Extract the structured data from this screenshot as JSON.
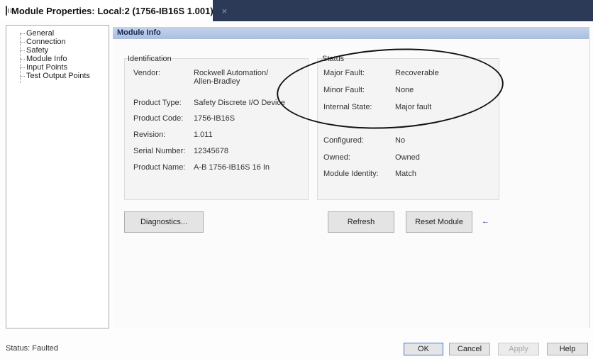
{
  "window": {
    "title": "Module Properties: Local:2 (1756-IB16S 1.001)",
    "close_glyph": "×"
  },
  "tree": {
    "items": [
      "General",
      "Connection",
      "Safety",
      "Module Info",
      "Input Points",
      "Test Output Points"
    ]
  },
  "panel": {
    "title": "Module Info"
  },
  "identification": {
    "label": "Identification",
    "vendor_label": "Vendor:",
    "vendor_value_line1": "Rockwell Automation/",
    "vendor_value_line2": "Allen-Bradley",
    "product_type_label": "Product Type:",
    "product_type_value": "Safety Discrete I/O Device",
    "product_code_label": "Product Code:",
    "product_code_value": "1756-IB16S",
    "revision_label": "Revision:",
    "revision_value": "1.011",
    "serial_label": "Serial Number:",
    "serial_value": "12345678",
    "product_name_label": "Product Name:",
    "product_name_value": "A-B 1756-IB16S 16 In"
  },
  "status": {
    "label": "Status",
    "major_fault_label": "Major Fault:",
    "major_fault_value": "Recoverable",
    "minor_fault_label": "Minor Fault:",
    "minor_fault_value": "None",
    "internal_state_label": "Internal State:",
    "internal_state_value": "Major fault",
    "configured_label": "Configured:",
    "configured_value": "No",
    "owned_label": "Owned:",
    "owned_value": "Owned",
    "module_identity_label": "Module Identity:",
    "module_identity_value": "Match"
  },
  "buttons": {
    "diagnostics": "Diagnostics...",
    "refresh": "Refresh",
    "reset_module": "Reset Module",
    "arrow_glyph": "←"
  },
  "footer": {
    "status_text": "Status:  Faulted",
    "ok": "OK",
    "cancel": "Cancel",
    "apply": "Apply",
    "help": "Help"
  },
  "colors": {
    "title_bar": "#2c3a57",
    "panel_header": "#aabfe0",
    "callout_arrow": "#1e2f8f"
  },
  "icons": {
    "window_icon": "module-properties-icon",
    "close_icon": "close-icon",
    "callout": "arrow-left-icon"
  }
}
